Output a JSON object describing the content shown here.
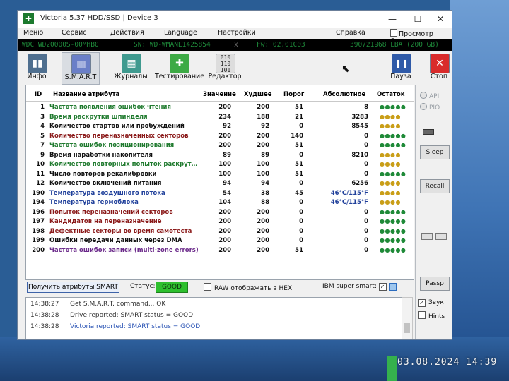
{
  "window": {
    "title": "Victoria 5.37 HDD/SSD | Device 3",
    "app_icon": "+"
  },
  "menu": [
    "Меню",
    "Сервис",
    "Действия",
    "Language",
    "Настройки",
    "Справка",
    "Просмотр буфера"
  ],
  "device": {
    "model": "WDC WD20000S-00MHB0",
    "serial": "SN: WD-WMANL1425854",
    "close": "x",
    "firmware": "Fw: 02.01C03",
    "capacity": "390721968 LBA (200 GB)"
  },
  "toolbar": {
    "left": [
      {
        "label": "Инфо",
        "icon": "info-icon"
      },
      {
        "label": "S.M.A.R.T",
        "icon": "smart-icon"
      },
      {
        "label": "Журналы",
        "icon": "logs-icon"
      },
      {
        "label": "Тестирование",
        "icon": "test-icon"
      },
      {
        "label": "Редактор",
        "icon": "editor-icon"
      }
    ],
    "pause": "Пауза",
    "stop": "Стоп"
  },
  "table": {
    "headers": [
      "ID",
      "Название атрибута",
      "Значение",
      "Худшее",
      "Порог",
      "Абсолютное",
      "Остаток"
    ],
    "rows": [
      {
        "id": "1",
        "name": "Частота появления ошибок чтения",
        "value": "200",
        "worst": "200",
        "thresh": "51",
        "raw": "8",
        "dots": "●●●●●",
        "color": "#1f7a2e",
        "dots_color": "green"
      },
      {
        "id": "3",
        "name": "Время раскрутки шпинделя",
        "value": "234",
        "worst": "188",
        "thresh": "21",
        "raw": "3283",
        "dots": "●●●●",
        "color": "#1f7a2e",
        "dots_color": "yellow"
      },
      {
        "id": "4",
        "name": "Количество стартов или пробуждений",
        "value": "92",
        "worst": "92",
        "thresh": "0",
        "raw": "8545",
        "dots": "●●●●",
        "color": "#111111",
        "dots_color": "yellow"
      },
      {
        "id": "5",
        "name": "Количество переназначенных секторов",
        "value": "200",
        "worst": "200",
        "thresh": "140",
        "raw": "0",
        "dots": "●●●●●",
        "color": "#8b1a1a",
        "dots_color": "green"
      },
      {
        "id": "7",
        "name": "Частота ошибок позиционирования",
        "value": "200",
        "worst": "200",
        "thresh": "51",
        "raw": "0",
        "dots": "●●●●●",
        "color": "#1f7a2e",
        "dots_color": "green"
      },
      {
        "id": "9",
        "name": "Время наработки накопителя",
        "value": "89",
        "worst": "89",
        "thresh": "0",
        "raw": "8210",
        "dots": "●●●●",
        "color": "#111111",
        "dots_color": "yellow"
      },
      {
        "id": "10",
        "name": "Количество повторных попыток раскрут…",
        "value": "100",
        "worst": "100",
        "thresh": "51",
        "raw": "0",
        "dots": "●●●●",
        "color": "#1f7a2e",
        "dots_color": "yellow"
      },
      {
        "id": "11",
        "name": "Число повторов рекалибровки",
        "value": "100",
        "worst": "100",
        "thresh": "51",
        "raw": "0",
        "dots": "●●●●●",
        "color": "#111111",
        "dots_color": "green"
      },
      {
        "id": "12",
        "name": "Количество включений питания",
        "value": "94",
        "worst": "94",
        "thresh": "0",
        "raw": "6256",
        "dots": "●●●●",
        "color": "#111111",
        "dots_color": "yellow"
      },
      {
        "id": "190",
        "name": "Температура воздушного потока",
        "value": "54",
        "worst": "38",
        "thresh": "45",
        "raw": "46°C/115°F",
        "dots": "●●●●",
        "color": "#1f3f9a",
        "dots_color": "yellow",
        "raw_blue": true
      },
      {
        "id": "194",
        "name": "Температура гермоблока",
        "value": "104",
        "worst": "88",
        "thresh": "0",
        "raw": "46°C/115°F",
        "dots": "●●●●",
        "color": "#1f3f9a",
        "dots_color": "yellow",
        "raw_blue": true
      },
      {
        "id": "196",
        "name": "Попыток переназначений секторов",
        "value": "200",
        "worst": "200",
        "thresh": "0",
        "raw": "0",
        "dots": "●●●●●",
        "color": "#8b1a1a",
        "dots_color": "green"
      },
      {
        "id": "197",
        "name": "Кандидатов на переназначение",
        "value": "200",
        "worst": "200",
        "thresh": "0",
        "raw": "0",
        "dots": "●●●●●",
        "color": "#8b1a1a",
        "dots_color": "green"
      },
      {
        "id": "198",
        "name": "Дефектные секторы во время самотеста",
        "value": "200",
        "worst": "200",
        "thresh": "0",
        "raw": "0",
        "dots": "●●●●●",
        "color": "#8b1a1a",
        "dots_color": "green"
      },
      {
        "id": "199",
        "name": "Ошибки передачи данных через DMA",
        "value": "200",
        "worst": "200",
        "thresh": "0",
        "raw": "0",
        "dots": "●●●●●",
        "color": "#111111",
        "dots_color": "green"
      },
      {
        "id": "200",
        "name": "Частота ошибок записи (multi-zone errors)",
        "value": "200",
        "worst": "200",
        "thresh": "51",
        "raw": "0",
        "dots": "●●●●●",
        "color": "#6b2a8a",
        "dots_color": "green"
      }
    ]
  },
  "side": {
    "api": "API",
    "pio": "PIO",
    "sleep": "Sleep",
    "recall": "Recall",
    "passp": "Passp",
    "sound": "Звук",
    "hints": "Hints"
  },
  "status": {
    "get_button": "Получить атрибуты SMART",
    "label": "Статус:",
    "value": "GOOD",
    "raw_hex": "RAW отображать в HEX",
    "ibm": "IBM super smart:",
    "ibm_check": "✓"
  },
  "log": [
    {
      "time": "14:38:27",
      "message": "Get S.M.A.R.T. command... OK",
      "blue": false
    },
    {
      "time": "14:38:28",
      "message": "Drive reported: SMART status = GOOD",
      "blue": false
    },
    {
      "time": "14:38:28",
      "message": "Victoria reported: SMART status = GOOD",
      "blue": true
    }
  ],
  "watermark": "03.08.2024 14:39"
}
